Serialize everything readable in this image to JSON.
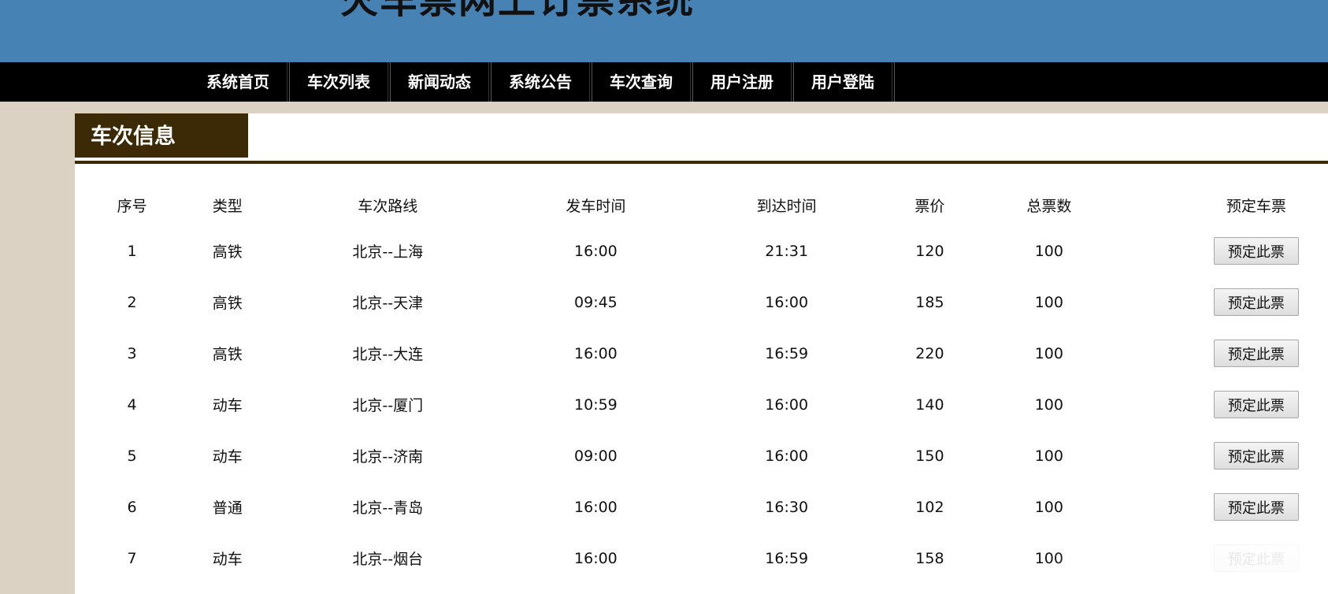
{
  "site": {
    "title": "火车票网上订票系统"
  },
  "nav": {
    "items": [
      {
        "label": "系统首页"
      },
      {
        "label": "车次列表"
      },
      {
        "label": "新闻动态"
      },
      {
        "label": "系统公告"
      },
      {
        "label": "车次查询"
      },
      {
        "label": "用户注册"
      },
      {
        "label": "用户登陆"
      }
    ]
  },
  "panel": {
    "title": "车次信息"
  },
  "table": {
    "headers": [
      "序号",
      "类型",
      "车次路线",
      "发车时间",
      "到达时间",
      "票价",
      "总票数",
      "预定车票"
    ],
    "rows": [
      {
        "id": "1",
        "type": "高铁",
        "route": "北京--上海",
        "depart": "16:00",
        "arrive": "21:31",
        "price": "120",
        "total": "100",
        "action": "预定此票"
      },
      {
        "id": "2",
        "type": "高铁",
        "route": "北京--天津",
        "depart": "09:45",
        "arrive": "16:00",
        "price": "185",
        "total": "100",
        "action": "预定此票"
      },
      {
        "id": "3",
        "type": "高铁",
        "route": "北京--大连",
        "depart": "16:00",
        "arrive": "16:59",
        "price": "220",
        "total": "100",
        "action": "预定此票"
      },
      {
        "id": "4",
        "type": "动车",
        "route": "北京--厦门",
        "depart": "10:59",
        "arrive": "16:00",
        "price": "140",
        "total": "100",
        "action": "预定此票"
      },
      {
        "id": "5",
        "type": "动车",
        "route": "北京--济南",
        "depart": "09:00",
        "arrive": "16:00",
        "price": "150",
        "total": "100",
        "action": "预定此票"
      },
      {
        "id": "6",
        "type": "普通",
        "route": "北京--青岛",
        "depart": "16:00",
        "arrive": "16:30",
        "price": "102",
        "total": "100",
        "action": "预定此票"
      },
      {
        "id": "7",
        "type": "动车",
        "route": "北京--烟台",
        "depart": "16:00",
        "arrive": "16:59",
        "price": "158",
        "total": "100",
        "action": "预定此票"
      }
    ]
  },
  "colors": {
    "banner": "#4682b4",
    "nav": "#000000",
    "page_bg": "#dcd2c4",
    "panel_accent": "#3b2a05"
  }
}
